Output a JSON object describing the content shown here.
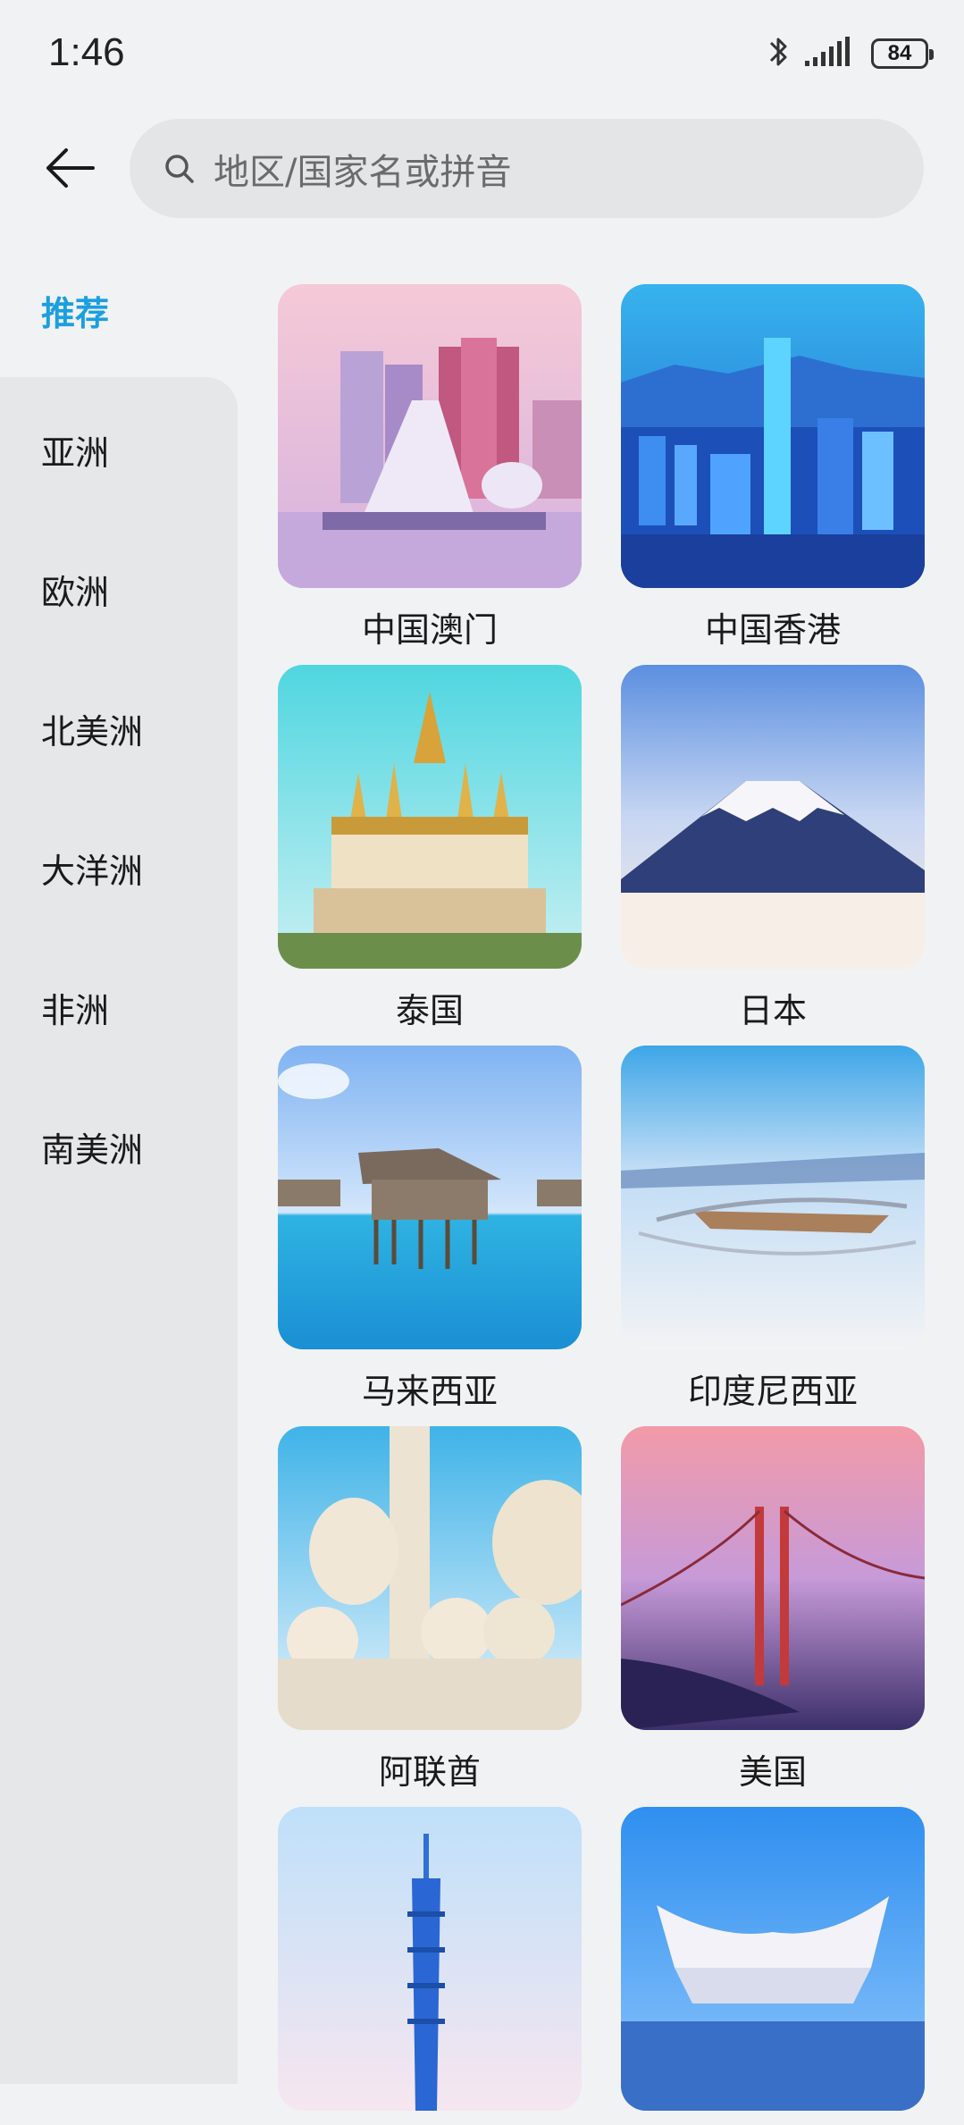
{
  "status_bar": {
    "time": "1:46",
    "battery": "84",
    "icons": [
      "bluetooth-icon",
      "signal-icon",
      "battery-icon"
    ]
  },
  "header": {
    "back_icon": "arrow-left-icon",
    "search": {
      "icon": "search-icon",
      "placeholder": "地区/国家名或拼音"
    }
  },
  "sidebar": {
    "active_color": "#1a9fe0",
    "items": [
      {
        "label": "推荐"
      },
      {
        "label": "亚洲"
      },
      {
        "label": "欧洲"
      },
      {
        "label": "北美洲"
      },
      {
        "label": "大洋洲"
      },
      {
        "label": "非洲"
      },
      {
        "label": "南美洲"
      }
    ]
  },
  "destinations": [
    {
      "label": "中国澳门"
    },
    {
      "label": "中国香港"
    },
    {
      "label": "泰国"
    },
    {
      "label": "日本"
    },
    {
      "label": "马来西亚"
    },
    {
      "label": "印度尼西亚"
    },
    {
      "label": "阿联酋"
    },
    {
      "label": "美国"
    },
    {
      "label": ""
    },
    {
      "label": ""
    }
  ]
}
